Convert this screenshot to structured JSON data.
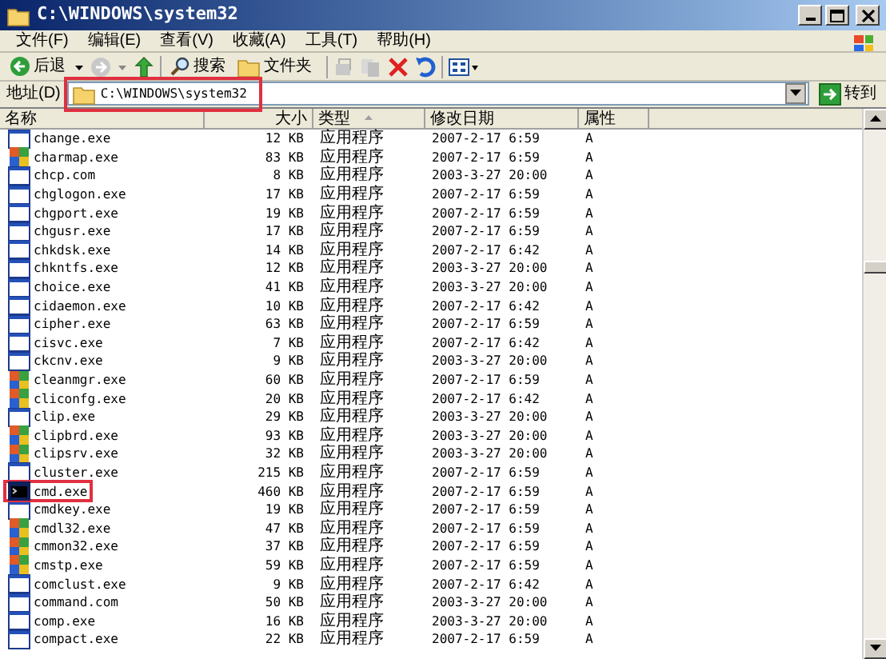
{
  "window": {
    "title": "C:\\WINDOWS\\system32"
  },
  "menu": [
    "文件(F)",
    "编辑(E)",
    "查看(V)",
    "收藏(A)",
    "工具(T)",
    "帮助(H)"
  ],
  "toolbar": {
    "back": "后退",
    "search": "搜索",
    "folders": "文件夹"
  },
  "address": {
    "label": "地址(D)",
    "value": "C:\\WINDOWS\\system32",
    "highlighted": true,
    "go": "转到"
  },
  "table": {
    "columns": [
      "名称",
      "大小",
      "类型",
      "修改日期",
      "属性"
    ],
    "rows": [
      {
        "name": "change.exe",
        "size": "12 KB",
        "type": "应用程序",
        "modified": "2007-2-17 6:59",
        "attr": "A",
        "kind": "window",
        "highlighted": false
      },
      {
        "name": "charmap.exe",
        "size": "83 KB",
        "type": "应用程序",
        "modified": "2007-2-17 6:59",
        "attr": "A",
        "kind": "color",
        "highlighted": false
      },
      {
        "name": "chcp.com",
        "size": "8 KB",
        "type": "应用程序",
        "modified": "2003-3-27 20:00",
        "attr": "A",
        "kind": "window",
        "highlighted": false
      },
      {
        "name": "chglogon.exe",
        "size": "17 KB",
        "type": "应用程序",
        "modified": "2007-2-17 6:59",
        "attr": "A",
        "kind": "window",
        "highlighted": false
      },
      {
        "name": "chgport.exe",
        "size": "19 KB",
        "type": "应用程序",
        "modified": "2007-2-17 6:59",
        "attr": "A",
        "kind": "window",
        "highlighted": false
      },
      {
        "name": "chgusr.exe",
        "size": "17 KB",
        "type": "应用程序",
        "modified": "2007-2-17 6:59",
        "attr": "A",
        "kind": "window",
        "highlighted": false
      },
      {
        "name": "chkdsk.exe",
        "size": "14 KB",
        "type": "应用程序",
        "modified": "2007-2-17 6:42",
        "attr": "A",
        "kind": "window",
        "highlighted": false
      },
      {
        "name": "chkntfs.exe",
        "size": "12 KB",
        "type": "应用程序",
        "modified": "2003-3-27 20:00",
        "attr": "A",
        "kind": "window",
        "highlighted": false
      },
      {
        "name": "choice.exe",
        "size": "41 KB",
        "type": "应用程序",
        "modified": "2003-3-27 20:00",
        "attr": "A",
        "kind": "window",
        "highlighted": false
      },
      {
        "name": "cidaemon.exe",
        "size": "10 KB",
        "type": "应用程序",
        "modified": "2007-2-17 6:42",
        "attr": "A",
        "kind": "window",
        "highlighted": false
      },
      {
        "name": "cipher.exe",
        "size": "63 KB",
        "type": "应用程序",
        "modified": "2007-2-17 6:59",
        "attr": "A",
        "kind": "window",
        "highlighted": false
      },
      {
        "name": "cisvc.exe",
        "size": "7 KB",
        "type": "应用程序",
        "modified": "2007-2-17 6:42",
        "attr": "A",
        "kind": "window",
        "highlighted": false
      },
      {
        "name": "ckcnv.exe",
        "size": "9 KB",
        "type": "应用程序",
        "modified": "2003-3-27 20:00",
        "attr": "A",
        "kind": "window",
        "highlighted": false
      },
      {
        "name": "cleanmgr.exe",
        "size": "60 KB",
        "type": "应用程序",
        "modified": "2007-2-17 6:59",
        "attr": "A",
        "kind": "color",
        "highlighted": false
      },
      {
        "name": "cliconfg.exe",
        "size": "20 KB",
        "type": "应用程序",
        "modified": "2007-2-17 6:42",
        "attr": "A",
        "kind": "color",
        "highlighted": false
      },
      {
        "name": "clip.exe",
        "size": "29 KB",
        "type": "应用程序",
        "modified": "2003-3-27 20:00",
        "attr": "A",
        "kind": "window",
        "highlighted": false
      },
      {
        "name": "clipbrd.exe",
        "size": "93 KB",
        "type": "应用程序",
        "modified": "2003-3-27 20:00",
        "attr": "A",
        "kind": "color",
        "highlighted": false
      },
      {
        "name": "clipsrv.exe",
        "size": "32 KB",
        "type": "应用程序",
        "modified": "2003-3-27 20:00",
        "attr": "A",
        "kind": "color",
        "highlighted": false
      },
      {
        "name": "cluster.exe",
        "size": "215 KB",
        "type": "应用程序",
        "modified": "2007-2-17 6:59",
        "attr": "A",
        "kind": "window",
        "highlighted": false
      },
      {
        "name": "cmd.exe",
        "size": "460 KB",
        "type": "应用程序",
        "modified": "2007-2-17 6:59",
        "attr": "A",
        "kind": "console",
        "highlighted": true
      },
      {
        "name": "cmdkey.exe",
        "size": "19 KB",
        "type": "应用程序",
        "modified": "2007-2-17 6:59",
        "attr": "A",
        "kind": "window",
        "highlighted": false
      },
      {
        "name": "cmdl32.exe",
        "size": "47 KB",
        "type": "应用程序",
        "modified": "2007-2-17 6:59",
        "attr": "A",
        "kind": "color",
        "highlighted": false
      },
      {
        "name": "cmmon32.exe",
        "size": "37 KB",
        "type": "应用程序",
        "modified": "2007-2-17 6:59",
        "attr": "A",
        "kind": "color",
        "highlighted": false
      },
      {
        "name": "cmstp.exe",
        "size": "59 KB",
        "type": "应用程序",
        "modified": "2007-2-17 6:59",
        "attr": "A",
        "kind": "color",
        "highlighted": false
      },
      {
        "name": "comclust.exe",
        "size": "9 KB",
        "type": "应用程序",
        "modified": "2007-2-17 6:42",
        "attr": "A",
        "kind": "window",
        "highlighted": false
      },
      {
        "name": "command.com",
        "size": "50 KB",
        "type": "应用程序",
        "modified": "2003-3-27 20:00",
        "attr": "A",
        "kind": "window",
        "highlighted": false
      },
      {
        "name": "comp.exe",
        "size": "16 KB",
        "type": "应用程序",
        "modified": "2003-3-27 20:00",
        "attr": "A",
        "kind": "window",
        "highlighted": false
      },
      {
        "name": "compact.exe",
        "size": "22 KB",
        "type": "应用程序",
        "modified": "2007-2-17 6:59",
        "attr": "A",
        "kind": "window",
        "highlighted": false
      }
    ]
  }
}
